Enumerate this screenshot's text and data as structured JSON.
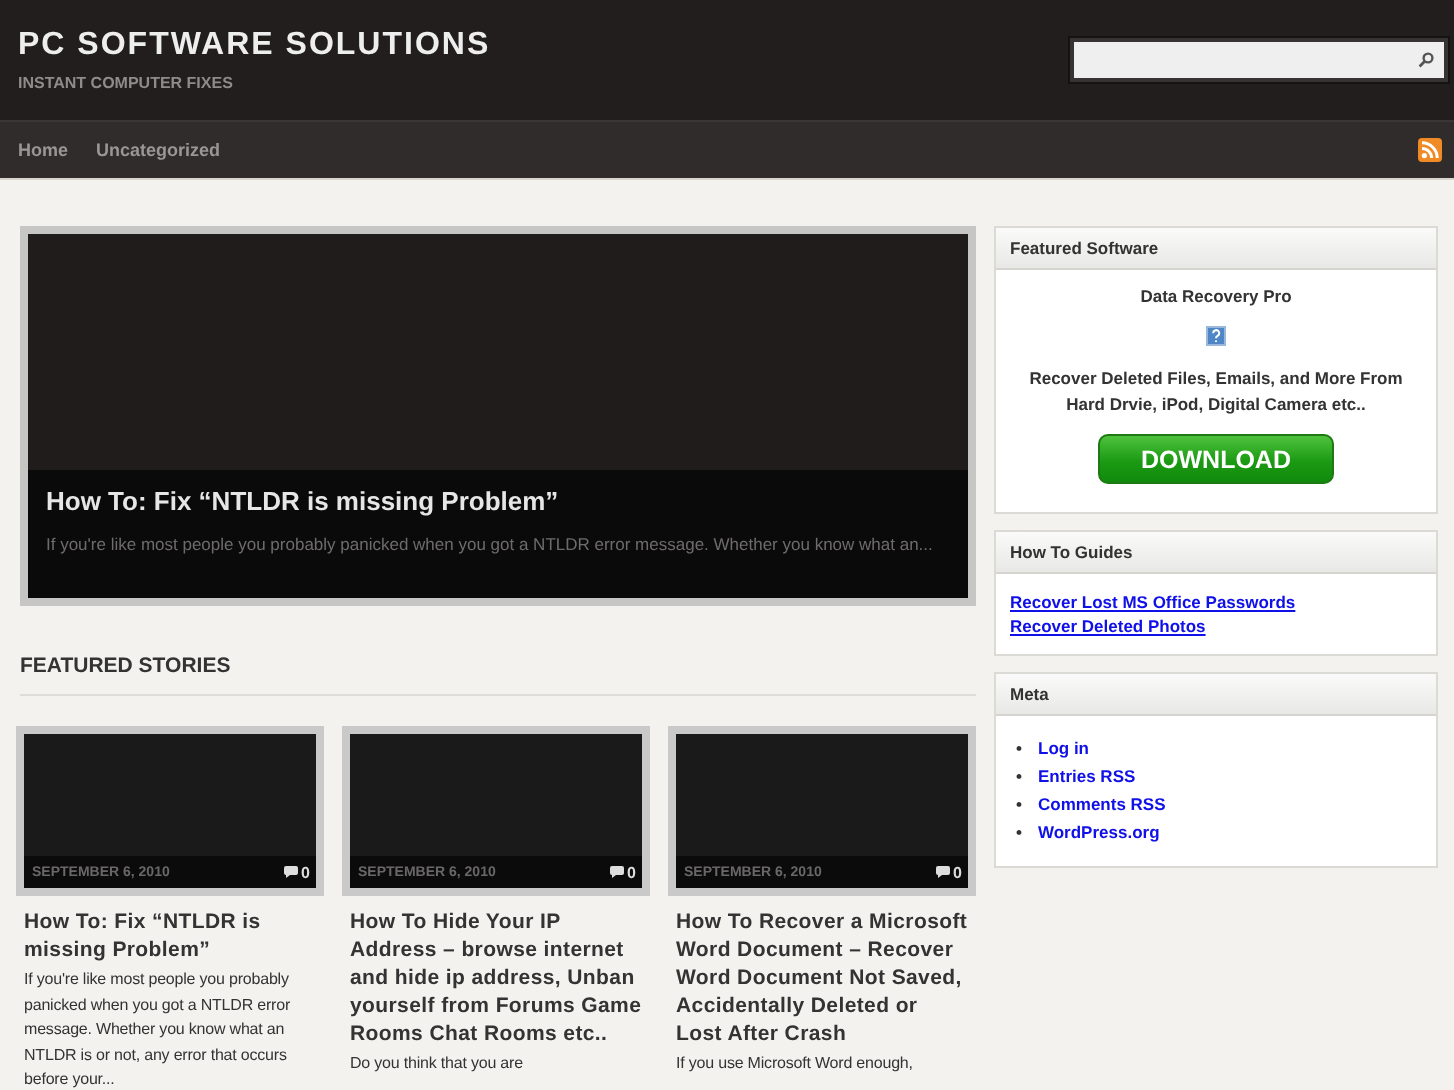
{
  "site": {
    "title": "PC SOFTWARE SOLUTIONS",
    "tagline": "INSTANT COMPUTER FIXES"
  },
  "nav": {
    "items": [
      {
        "label": "Home"
      },
      {
        "label": "Uncategorized"
      }
    ]
  },
  "slider": {
    "title": "How To: Fix “NTLDR is missing Problem”",
    "excerpt": "If you're like most people you probably panicked when you got a NTLDR error message. Whether you know what an..."
  },
  "featured_stories": {
    "heading": "FEATURED STORIES",
    "stories": [
      {
        "date": "SEPTEMBER 6, 2010",
        "comments": "0",
        "title": "How To: Fix “NTLDR is missing Problem”",
        "excerpt": "If you're like most people you probably panicked when you got a NTLDR error message. Whether you know what an NTLDR is or not, any error that occurs before your..."
      },
      {
        "date": "SEPTEMBER 6, 2010",
        "comments": "0",
        "title": "How To Hide Your IP Address – browse internet and hide ip address, Unban yourself from Forums Game Rooms Chat Rooms etc..",
        "excerpt": "Do you think that you are"
      },
      {
        "date": "SEPTEMBER 6, 2010",
        "comments": "0",
        "title": "How To Recover a Microsoft Word Document – Recover Word Document Not Saved, Accidentally Deleted or Lost After Crash",
        "excerpt": "If you use Microsoft Word enough,"
      }
    ]
  },
  "sidebar": {
    "widgets": [
      {
        "kind": "product",
        "title": "Featured Software",
        "name": "Data Recovery Pro",
        "description": "Recover Deleted Files, Emails, and More From Hard Drvie, iPod, Digital Camera etc..",
        "button": "DOWNLOAD"
      },
      {
        "kind": "links",
        "title": "How To Guides",
        "links": [
          "Recover Lost MS Office Passwords",
          "Recover Deleted Photos"
        ]
      },
      {
        "kind": "bullets",
        "title": "Meta",
        "items": [
          {
            "bullet": "•",
            "label": "Log in"
          },
          {
            "bullet": "•",
            "label": "Entries RSS"
          },
          {
            "bullet": "•",
            "label": "Comments RSS"
          },
          {
            "bullet": "•",
            "label": "WordPress.org"
          }
        ]
      }
    ]
  }
}
